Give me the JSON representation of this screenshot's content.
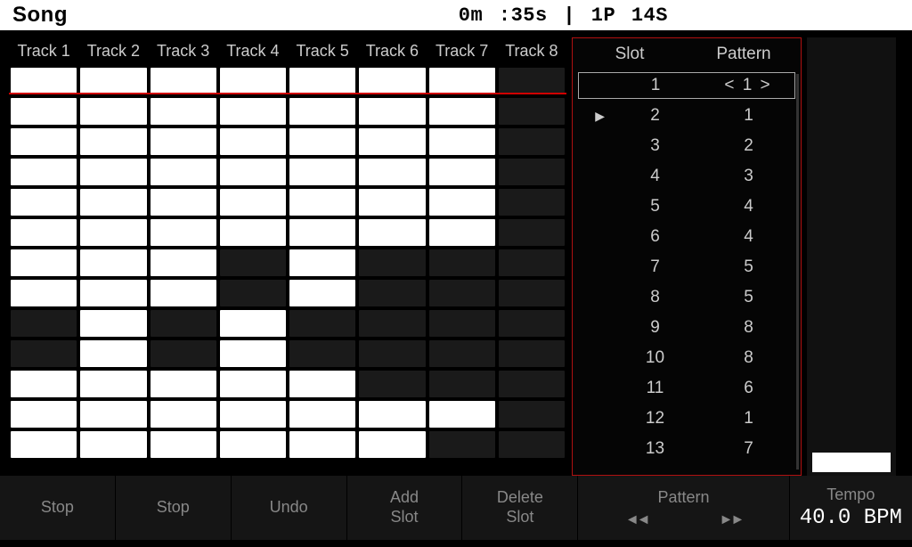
{
  "header": {
    "title": "Song",
    "status": "0m :35s |  1P  14S"
  },
  "tracks": {
    "headers": [
      "Track 1",
      "Track 2",
      "Track 3",
      "Track 4",
      "Track 5",
      "Track 6",
      "Track 7",
      "Track 8"
    ],
    "grid": [
      [
        1,
        1,
        1,
        1,
        1,
        1,
        1,
        0
      ],
      [
        1,
        1,
        1,
        1,
        1,
        1,
        1,
        0
      ],
      [
        1,
        1,
        1,
        1,
        1,
        1,
        1,
        0
      ],
      [
        1,
        1,
        1,
        1,
        1,
        1,
        1,
        0
      ],
      [
        1,
        1,
        1,
        1,
        1,
        1,
        1,
        0
      ],
      [
        1,
        1,
        1,
        1,
        1,
        1,
        1,
        0
      ],
      [
        1,
        1,
        1,
        0,
        1,
        0,
        0,
        0
      ],
      [
        1,
        1,
        1,
        0,
        1,
        0,
        0,
        0
      ],
      [
        0,
        1,
        0,
        1,
        0,
        0,
        0,
        0
      ],
      [
        0,
        1,
        0,
        1,
        0,
        0,
        0,
        0
      ],
      [
        1,
        1,
        1,
        1,
        1,
        0,
        0,
        0
      ],
      [
        1,
        1,
        1,
        1,
        1,
        1,
        1,
        0
      ],
      [
        1,
        1,
        1,
        1,
        1,
        1,
        0,
        0
      ]
    ],
    "playhead_row": 1
  },
  "panel": {
    "headers": {
      "slot": "Slot",
      "pattern": "Pattern"
    },
    "selected_index": 0,
    "playing_index": 1,
    "rows": [
      {
        "slot": "1",
        "pattern": "< 1 >"
      },
      {
        "slot": "2",
        "pattern": "1"
      },
      {
        "slot": "3",
        "pattern": "2"
      },
      {
        "slot": "4",
        "pattern": "3"
      },
      {
        "slot": "5",
        "pattern": "4"
      },
      {
        "slot": "6",
        "pattern": "4"
      },
      {
        "slot": "7",
        "pattern": "5"
      },
      {
        "slot": "8",
        "pattern": "5"
      },
      {
        "slot": "9",
        "pattern": "8"
      },
      {
        "slot": "10",
        "pattern": "8"
      },
      {
        "slot": "11",
        "pattern": "6"
      },
      {
        "slot": "12",
        "pattern": "1"
      },
      {
        "slot": "13",
        "pattern": "7"
      }
    ]
  },
  "bottom": {
    "buttons": [
      "Stop",
      "Stop",
      "Undo",
      "Add\nSlot",
      "Delete\nSlot"
    ],
    "pattern_label": "Pattern",
    "tempo_label": "Tempo",
    "tempo_value": "40.0 BPM"
  }
}
